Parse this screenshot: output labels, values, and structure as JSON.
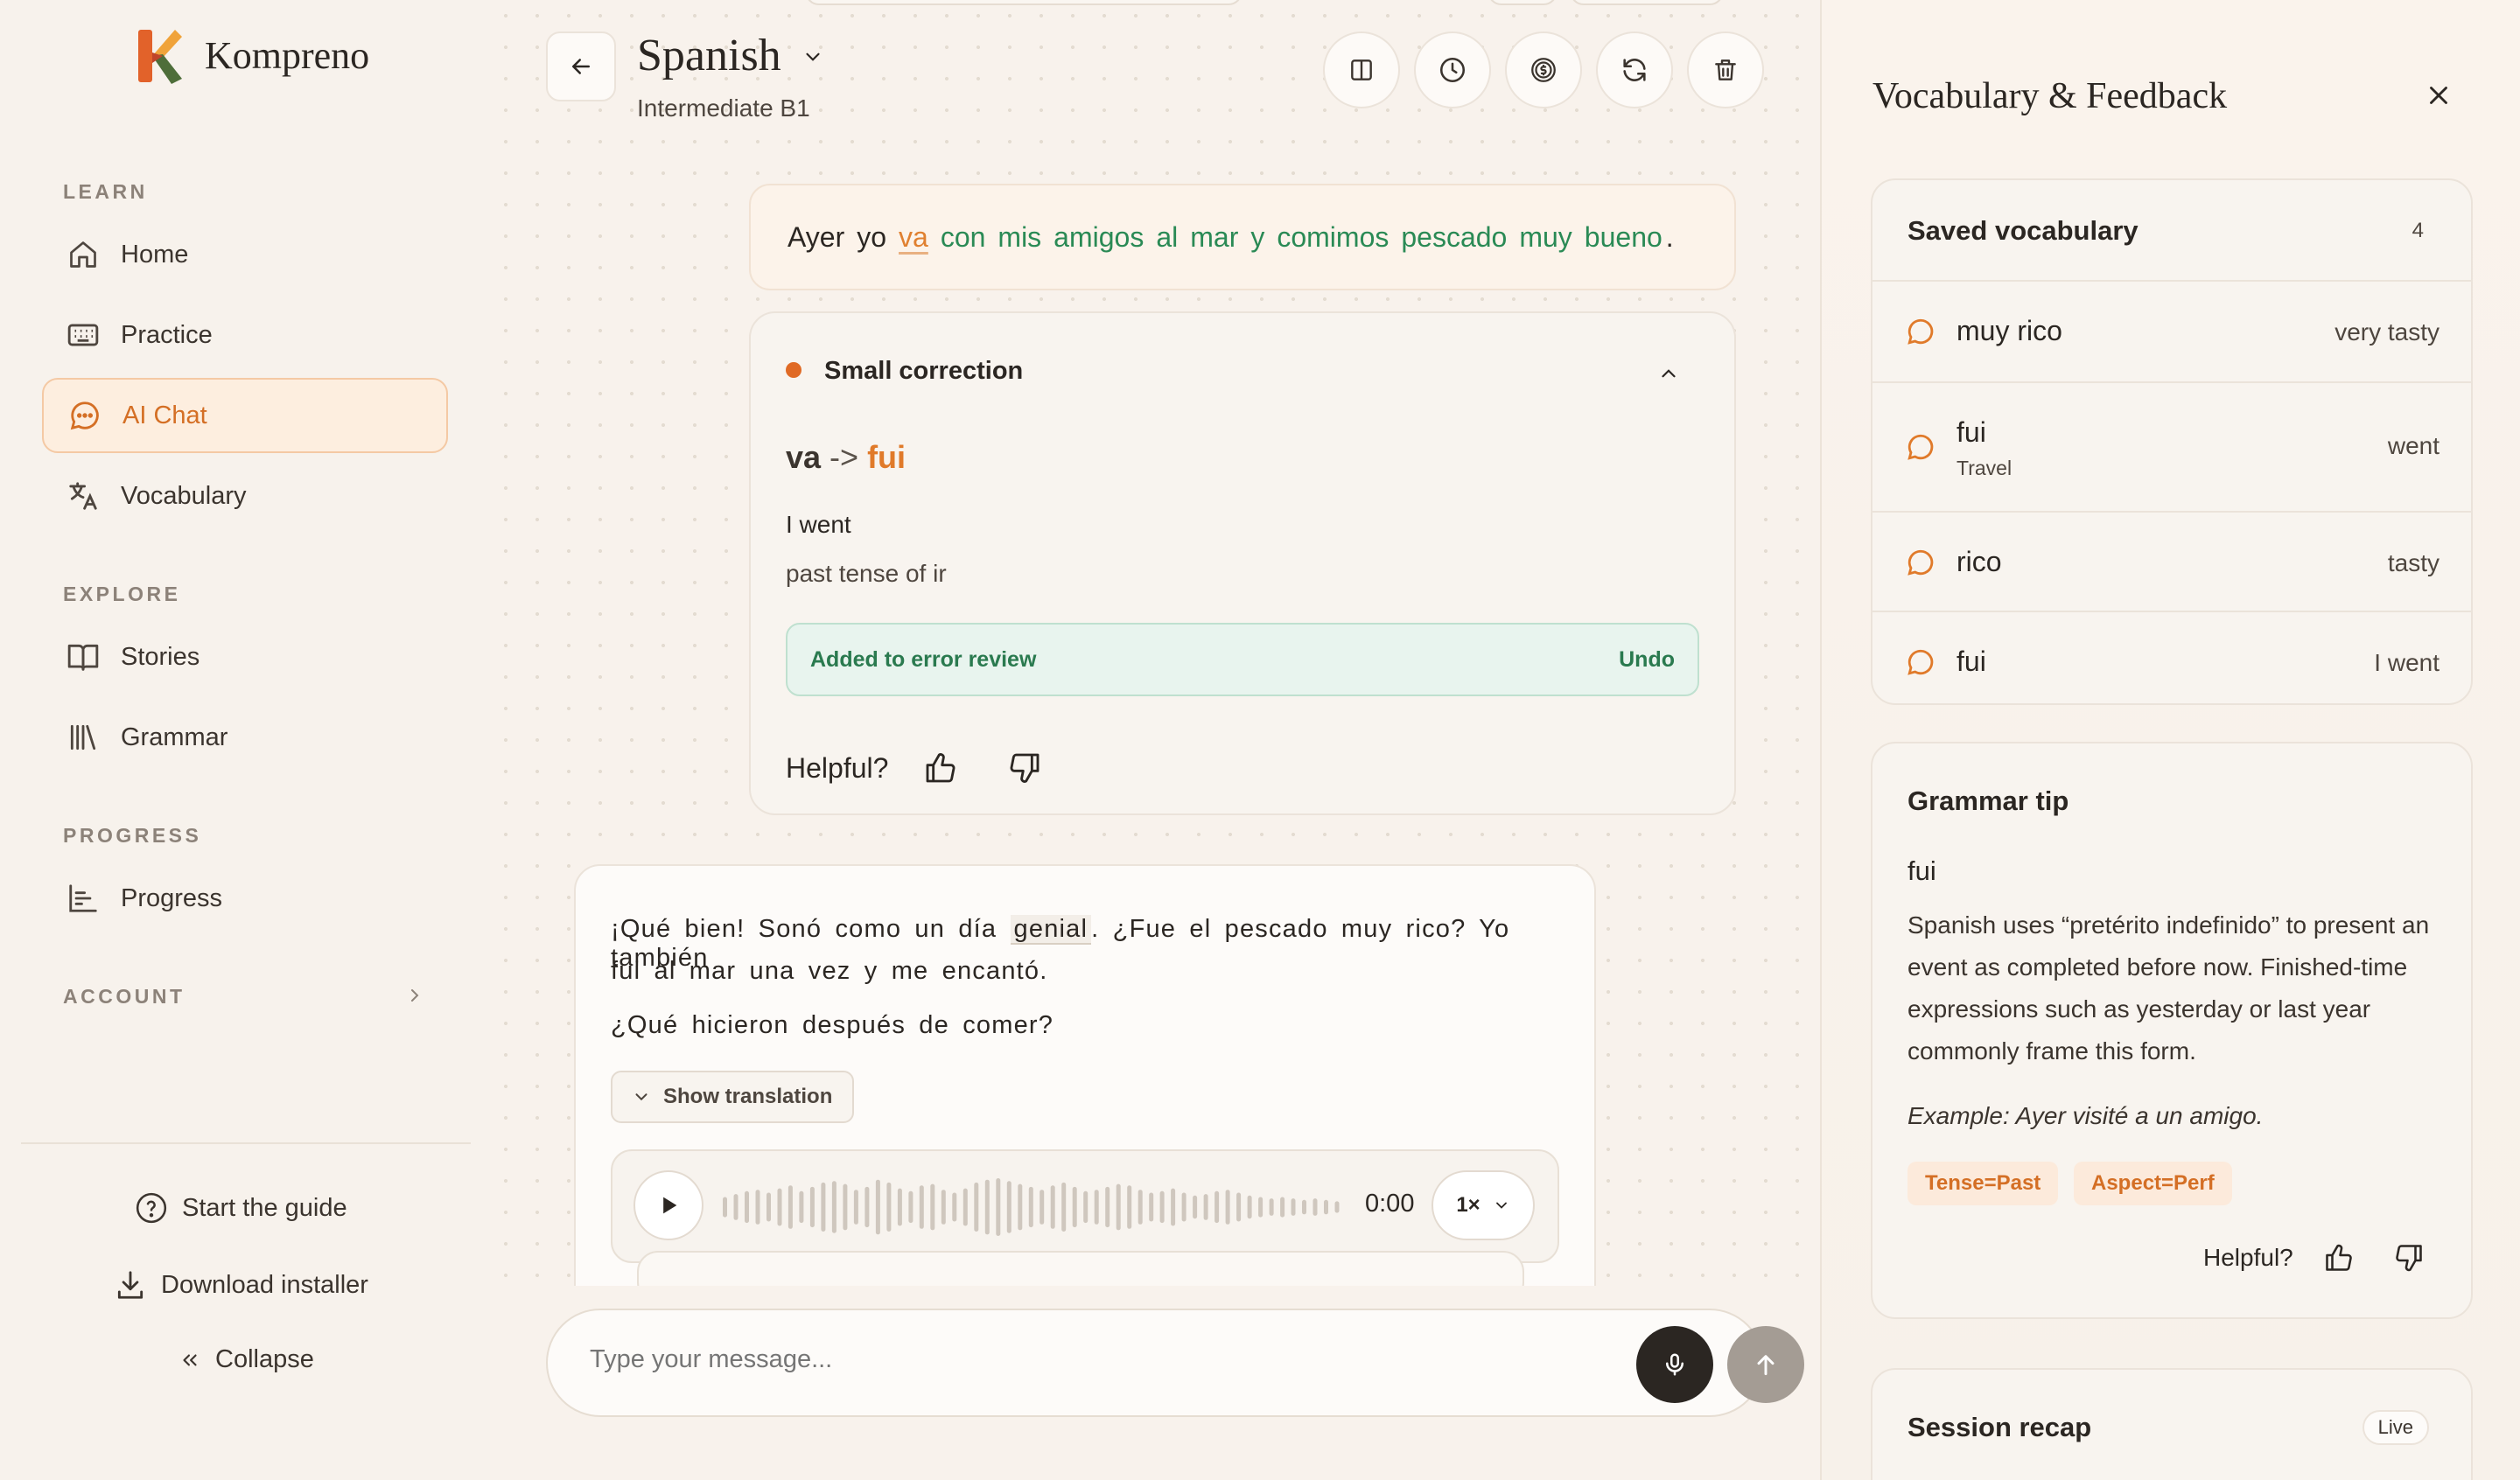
{
  "app": {
    "brand": "Kompreno"
  },
  "sidebar": {
    "sections": {
      "learn": "LEARN",
      "explore": "EXPLORE",
      "progress": "PROGRESS",
      "account": "ACCOUNT"
    },
    "items": [
      {
        "label": "Home",
        "icon": "home-icon"
      },
      {
        "label": "Practice",
        "icon": "keyboard-icon"
      },
      {
        "label": "AI Chat",
        "icon": "chat-bubble-icon",
        "active": true
      },
      {
        "label": "Vocabulary",
        "icon": "translate-icon"
      },
      {
        "label": "Stories",
        "icon": "book-icon"
      },
      {
        "label": "Grammar",
        "icon": "library-icon"
      },
      {
        "label": "Progress",
        "icon": "bar-chart-icon"
      }
    ],
    "footer": {
      "guide": "Start the guide",
      "download": "Download installer",
      "collapse": "Collapse"
    }
  },
  "header": {
    "language": "Spanish",
    "level": "Intermediate B1",
    "actions": [
      "split-view-icon",
      "history-icon",
      "coins-icon",
      "refresh-icon",
      "trash-icon"
    ]
  },
  "user_message": {
    "words": [
      {
        "t": "Ayer",
        "s": "plain"
      },
      {
        "t": "yo",
        "s": "plain"
      },
      {
        "t": "va",
        "s": "err"
      },
      {
        "t": "con",
        "s": "ok"
      },
      {
        "t": "mis",
        "s": "ok"
      },
      {
        "t": "amigos",
        "s": "ok"
      },
      {
        "t": "al",
        "s": "ok"
      },
      {
        "t": "mar",
        "s": "ok"
      },
      {
        "t": "y",
        "s": "ok"
      },
      {
        "t": "comimos",
        "s": "ok"
      },
      {
        "t": "pescado",
        "s": "ok"
      },
      {
        "t": "muy",
        "s": "ok"
      },
      {
        "t": "bueno",
        "s": "ok"
      },
      {
        "t": ".",
        "s": "plain"
      }
    ]
  },
  "correction": {
    "title": "Small correction",
    "from": "va",
    "arrow": "->",
    "to": "fui",
    "meaning": "I went",
    "note": "past tense of ir",
    "review_text": "Added to error review",
    "undo": "Undo",
    "helpful": "Helpful?"
  },
  "ai_message": {
    "line1_a": "¡Qué bien! Sonó como un día",
    "highlight": "genial",
    "line1_b": ". ¿Fue el pescado muy rico? Yo también",
    "line2": "fui al mar una vez y me encantó.",
    "line3": "¿Qué hicieron después de comer?",
    "show_translation": "Show translation",
    "audio_time": "0:00",
    "speed": "1×",
    "waveform": [
      0.35,
      0.45,
      0.55,
      0.6,
      0.5,
      0.65,
      0.75,
      0.55,
      0.7,
      0.85,
      0.9,
      0.8,
      0.6,
      0.7,
      0.95,
      0.85,
      0.65,
      0.55,
      0.75,
      0.8,
      0.6,
      0.5,
      0.65,
      0.85,
      0.95,
      1.0,
      0.9,
      0.8,
      0.7,
      0.6,
      0.75,
      0.85,
      0.7,
      0.55,
      0.6,
      0.7,
      0.8,
      0.75,
      0.6,
      0.5,
      0.55,
      0.65,
      0.5,
      0.4,
      0.45,
      0.55,
      0.6,
      0.5,
      0.4,
      0.35,
      0.3,
      0.35,
      0.3,
      0.25,
      0.3,
      0.25,
      0.2
    ]
  },
  "composer": {
    "placeholder": "Type your message..."
  },
  "right_panel": {
    "title": "Vocabulary & Feedback",
    "saved": {
      "title": "Saved vocabulary",
      "count": "4",
      "items": [
        {
          "word": "muy rico",
          "sub": "",
          "trans": "very tasty"
        },
        {
          "word": "fui",
          "sub": "Travel",
          "trans": "went"
        },
        {
          "word": "rico",
          "sub": "",
          "trans": "tasty"
        },
        {
          "word": "fui",
          "sub": "",
          "trans": "I went"
        }
      ]
    },
    "grammar": {
      "title": "Grammar tip",
      "word": "fui",
      "body": "Spanish uses “pretérito indefinido” to present an event as completed before now. Finished-time expressions such as yesterday or last year commonly frame this form.",
      "example": "Example: Ayer visité a un amigo.",
      "tags": [
        "Tense=Past",
        "Aspect=Perf"
      ],
      "helpful": "Helpful?"
    },
    "recap": {
      "title": "Session recap",
      "badge": "Live"
    }
  },
  "colors": {
    "accent": "#d46f25",
    "success": "#2a8a55",
    "error": "#e08030"
  }
}
